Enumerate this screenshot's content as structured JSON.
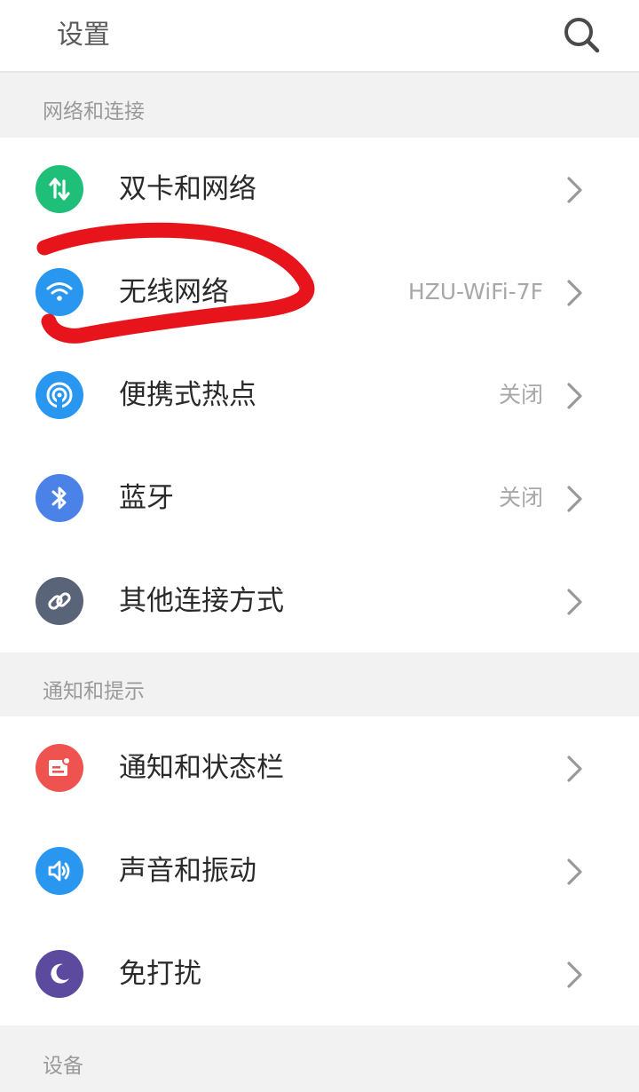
{
  "header": {
    "title": "设置",
    "search_icon": "search-icon"
  },
  "sections": [
    {
      "header": "网络和连接",
      "items": [
        {
          "label": "双卡和网络",
          "value": "",
          "icon": "data-transfer-icon",
          "color": "#1fbf7a"
        },
        {
          "label": "无线网络",
          "value": "HZU-WiFi-7F",
          "icon": "wifi-icon",
          "color": "#2996ef"
        },
        {
          "label": "便携式热点",
          "value": "关闭",
          "icon": "hotspot-icon",
          "color": "#2996ef"
        },
        {
          "label": "蓝牙",
          "value": "关闭",
          "icon": "bluetooth-icon",
          "color": "#4a82e8"
        },
        {
          "label": "其他连接方式",
          "value": "",
          "icon": "link-icon",
          "color": "#5a6478"
        }
      ]
    },
    {
      "header": "通知和提示",
      "items": [
        {
          "label": "通知和状态栏",
          "value": "",
          "icon": "notification-icon",
          "color": "#ef5350"
        },
        {
          "label": "声音和振动",
          "value": "",
          "icon": "sound-icon",
          "color": "#2996ef"
        },
        {
          "label": "免打扰",
          "value": "",
          "icon": "moon-icon",
          "color": "#5b4a9e"
        }
      ]
    },
    {
      "header": "设备",
      "items": []
    }
  ],
  "annotation_color": "#e8141c"
}
